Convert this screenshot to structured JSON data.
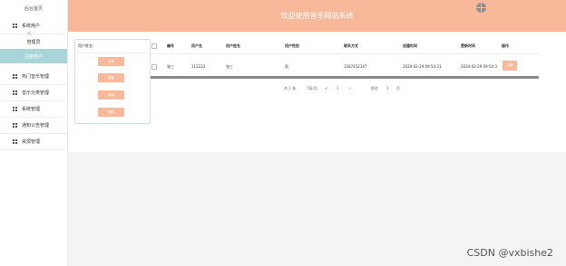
{
  "sidebar": {
    "top_label": "后台首页",
    "items": [
      {
        "label": "系统用户",
        "icon": "grid-icon"
      },
      {
        "label": "热门音乐管理",
        "icon": "grid-icon"
      },
      {
        "label": "音乐分类管理",
        "icon": "grid-icon"
      },
      {
        "label": "系统管理",
        "icon": "grid-icon"
      },
      {
        "label": "通知公告管理",
        "icon": "grid-icon"
      },
      {
        "label": "资源管理",
        "icon": "grid-icon"
      }
    ],
    "subitems": [
      {
        "label": "管理员"
      },
      {
        "label": "注册用户"
      }
    ]
  },
  "header": {
    "title": "欢迎使用音乐网站系统",
    "avatar_icon": "avatar-icon"
  },
  "panel": {
    "label": "用户姓名：",
    "buttons": [
      "查询",
      "重置",
      "添加",
      "删除"
    ]
  },
  "table": {
    "headers": [
      "编号",
      "用户名",
      "用户姓名",
      "用户性别",
      "联系方式",
      "创建时间",
      "更新时间",
      "操作"
    ],
    "rows": [
      {
        "id": "张三",
        "username": "112233",
        "name": "张三",
        "gender": "男",
        "phone": "1587452147",
        "created": "2024-02-29 09:54:31",
        "updated": "2024-02-29 09:54:3",
        "action": "详情"
      }
    ]
  },
  "pagination": {
    "total": "共 1 条",
    "page_size": "7条/页",
    "prev": "<",
    "current": "1",
    "next": ">",
    "goto_label": "前往",
    "goto_value": "1",
    "page_unit": "页"
  },
  "watermark": "CSDN @vxbishe2",
  "colors": {
    "accent": "#f8b89a",
    "active_menu": "#a9d5d9",
    "background": "#f4f4f5"
  }
}
